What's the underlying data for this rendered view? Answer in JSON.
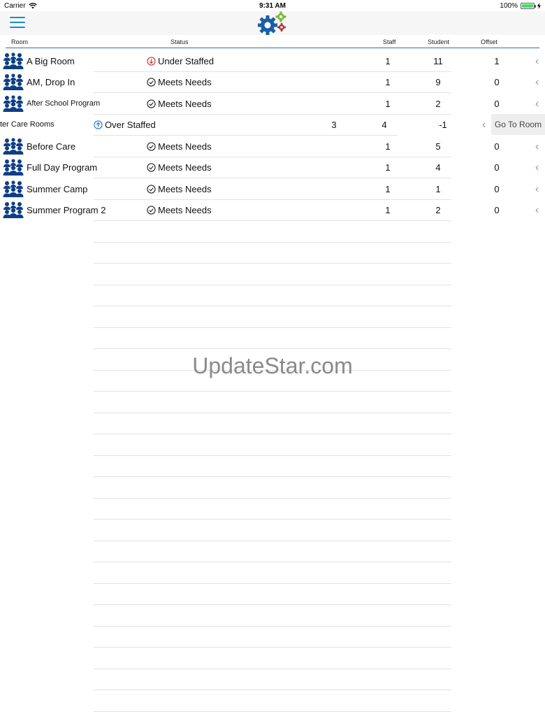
{
  "status_bar": {
    "carrier": "Carrier",
    "time": "9:31 AM",
    "battery": "100%",
    "battery_level": 1.0
  },
  "columns": {
    "room": "Room",
    "status": "Status",
    "staff": "Staff",
    "student": "Student",
    "offset": "Offset"
  },
  "rows": [
    {
      "name": "A Big Room",
      "status": "Under Staffed",
      "staff": "1",
      "student": "11",
      "offset": "1"
    },
    {
      "name": "AM, Drop In",
      "status": "Meets Needs",
      "staff": "1",
      "student": "9",
      "offset": "0"
    },
    {
      "name": "After School Program",
      "status": "Meets Needs",
      "staff": "1",
      "student": "2",
      "offset": "0"
    },
    {
      "name": "ter Care Rooms",
      "status": "Over Staffed",
      "staff": "3",
      "student": "4",
      "offset": "-1",
      "action": "Go To Room"
    },
    {
      "name": "Before Care",
      "status": "Meets Needs",
      "staff": "1",
      "student": "5",
      "offset": "0"
    },
    {
      "name": "Full Day Program",
      "status": "Meets Needs",
      "staff": "1",
      "student": "4",
      "offset": "0"
    },
    {
      "name": "Summer Camp",
      "status": "Meets Needs",
      "staff": "1",
      "student": "1",
      "offset": "0"
    },
    {
      "name": "Summer Program 2",
      "status": "Meets Needs",
      "staff": "1",
      "student": "2",
      "offset": "0"
    }
  ],
  "watermark": "UpdateStar.com",
  "icons": {
    "menu": "hamburger-icon",
    "logo": "gears-logo-icon",
    "room": "group-people-icon",
    "under_staffed": "arrow-down-circle-icon",
    "meets_needs": "check-circle-icon",
    "over_staffed": "arrow-up-circle-icon",
    "row_chevron": "chevron-left-icon"
  },
  "colors": {
    "accent": "#1a8ad4",
    "header_line": "#2a6fb0",
    "room_icon": "#0d3f86",
    "under_staffed": "#d0312d",
    "over_staffed": "#1a7ad4",
    "meets_needs": "#222222",
    "gear_blue": "#1a5fa8",
    "gear_green": "#7cb832",
    "gear_red": "#b02a2a"
  }
}
